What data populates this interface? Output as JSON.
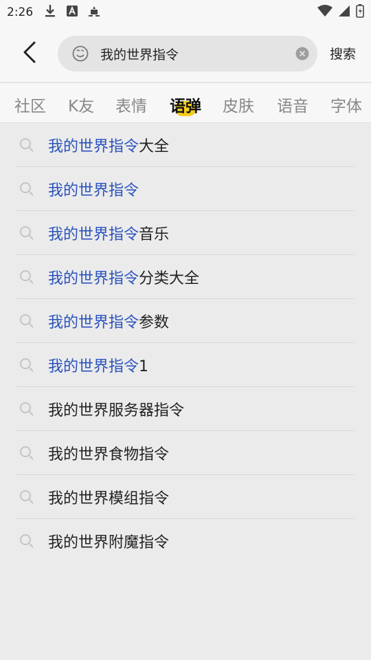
{
  "status_bar": {
    "time": "2:26",
    "icons": [
      "download-icon",
      "text-a-icon",
      "android-debug-icon"
    ],
    "right_icons": [
      "wifi-icon",
      "signal-icon",
      "battery-icon"
    ]
  },
  "header": {
    "back_icon": "back-arrow-icon",
    "search": {
      "value": "我的世界指令",
      "emoji_icon": "emoji-face-icon",
      "clear_icon": "clear-icon"
    },
    "search_button_label": "搜索"
  },
  "tabs": [
    {
      "label": "社区",
      "active": false
    },
    {
      "label": "K友",
      "active": false
    },
    {
      "label": "表情",
      "active": false
    },
    {
      "label": "语弹",
      "active": true
    },
    {
      "label": "皮肤",
      "active": false
    },
    {
      "label": "语音",
      "active": false
    },
    {
      "label": "字体",
      "active": false
    }
  ],
  "accent_color": "#f5cd1f",
  "highlight_color": "#2a52be",
  "suggestions": [
    {
      "highlight": "我的世界指令",
      "rest": "大全"
    },
    {
      "highlight": "我的世界指令",
      "rest": ""
    },
    {
      "highlight": "我的世界指令",
      "rest": "音乐"
    },
    {
      "highlight": "我的世界指令",
      "rest": "分类大全"
    },
    {
      "highlight": "我的世界指令",
      "rest": "参数"
    },
    {
      "highlight": "我的世界指令",
      "rest": "1"
    },
    {
      "highlight": "",
      "rest": "我的世界服务器指令"
    },
    {
      "highlight": "",
      "rest": "我的世界食物指令"
    },
    {
      "highlight": "",
      "rest": "我的世界模组指令"
    },
    {
      "highlight": "",
      "rest": "我的世界附魔指令"
    }
  ]
}
